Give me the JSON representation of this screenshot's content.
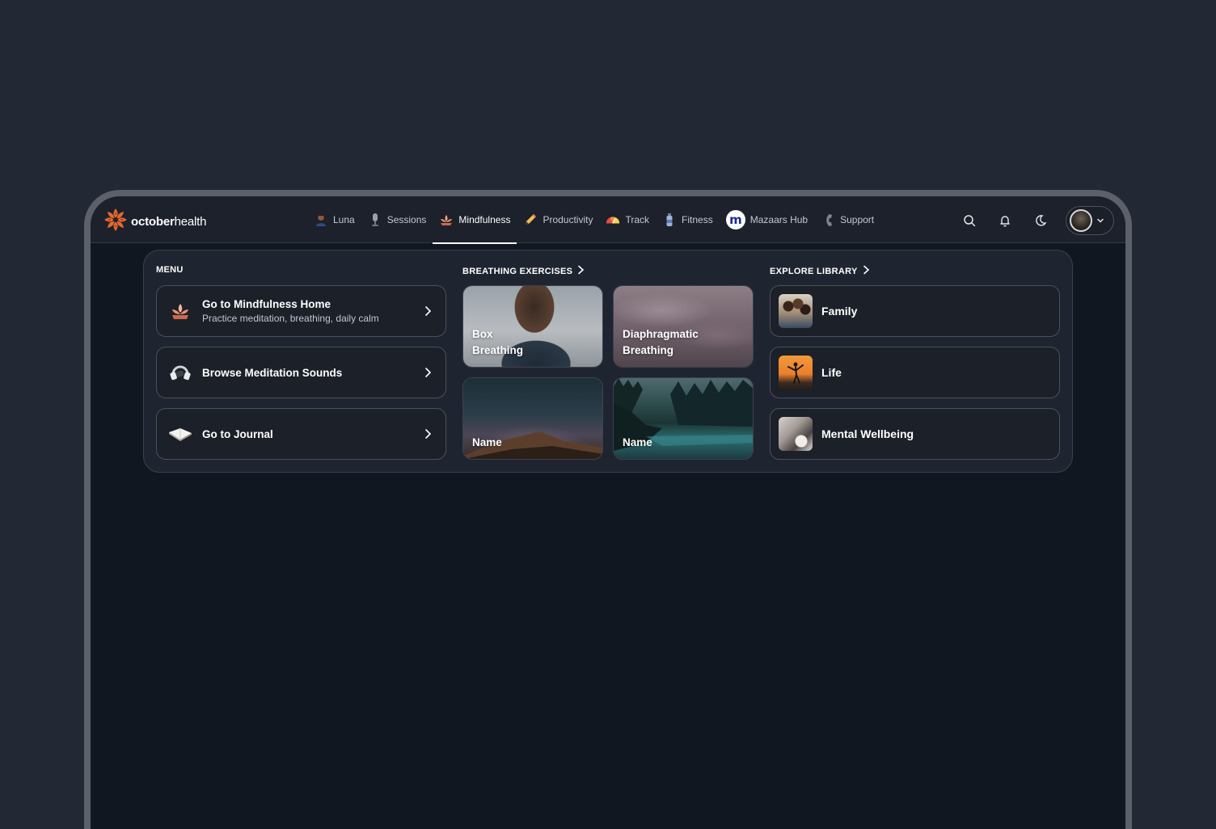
{
  "brand": {
    "name_bold": "october",
    "name_light": "health",
    "accent": "#e8692c"
  },
  "nav": [
    {
      "id": "luna",
      "label": "Luna",
      "icon": "person-avatar-icon",
      "active": false
    },
    {
      "id": "sessions",
      "label": "Sessions",
      "icon": "microphone-icon",
      "active": false
    },
    {
      "id": "mindfulness",
      "label": "Mindfulness",
      "icon": "lotus-icon",
      "active": true
    },
    {
      "id": "productivity",
      "label": "Productivity",
      "icon": "pencil-icon",
      "active": false
    },
    {
      "id": "track",
      "label": "Track",
      "icon": "gauge-icon",
      "active": false
    },
    {
      "id": "fitness",
      "label": "Fitness",
      "icon": "water-bottle-icon",
      "active": false
    },
    {
      "id": "mazaars",
      "label": "Mazaars Hub",
      "icon": "mazaars-logo-icon",
      "active": false
    },
    {
      "id": "support",
      "label": "Support",
      "icon": "phone-handset-icon",
      "active": false
    }
  ],
  "menu": {
    "title": "MENU",
    "items": [
      {
        "title": "Go to Mindfulness Home",
        "subtitle": "Practice meditation, breathing, daily calm",
        "icon": "lotus-icon"
      },
      {
        "title": "Browse Meditation Sounds",
        "subtitle": "",
        "icon": "headphones-icon"
      },
      {
        "title": "Go to Journal",
        "subtitle": "",
        "icon": "open-book-icon"
      }
    ]
  },
  "breathing": {
    "title": "BREATHING EXERCISES",
    "tiles": [
      {
        "line1": "Box",
        "line2": "Breathing"
      },
      {
        "line1": "Diaphragmatic",
        "line2": "Breathing"
      },
      {
        "line1": "Name",
        "line2": ""
      },
      {
        "line1": "Name",
        "line2": ""
      }
    ]
  },
  "library": {
    "title": "EXPLORE LIBRARY",
    "items": [
      {
        "label": "Family"
      },
      {
        "label": "Life"
      },
      {
        "label": "Mental Wellbeing"
      }
    ]
  }
}
